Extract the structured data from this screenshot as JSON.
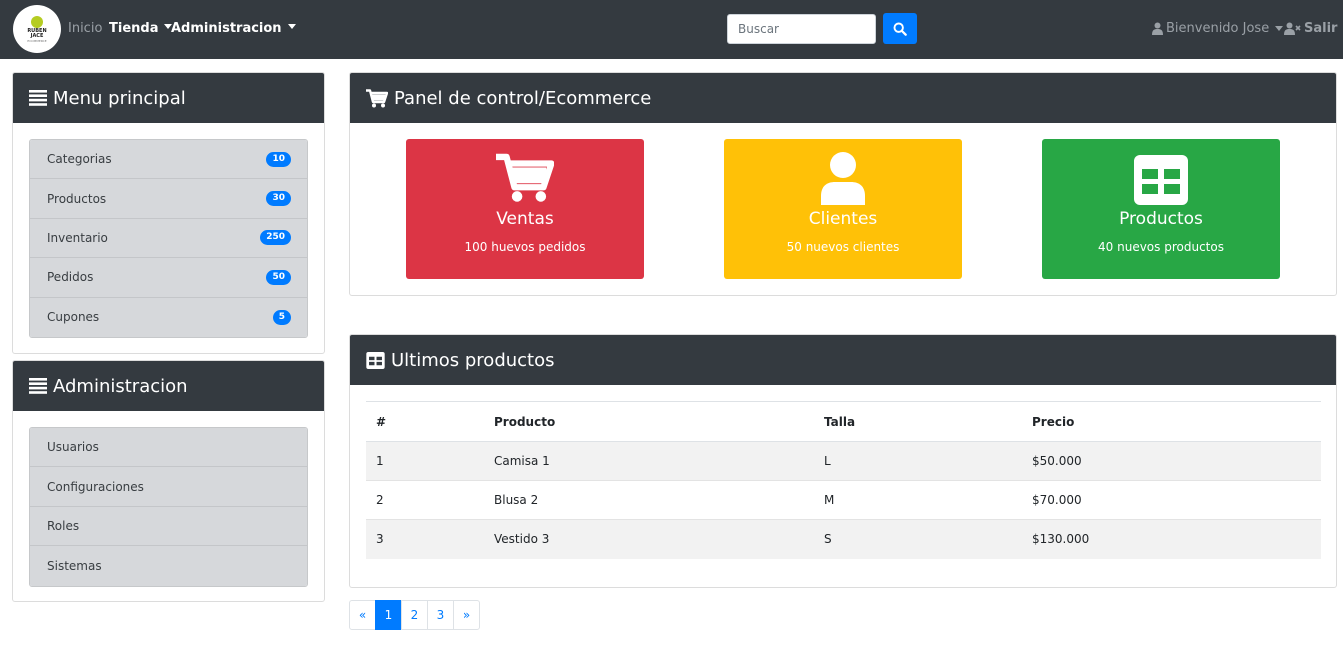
{
  "navbar": {
    "logo": {
      "line1": "RUBEN",
      "line2": "JACE",
      "line3": "ECOMMERCE"
    },
    "links": {
      "home": "Inicio",
      "store": "Tienda",
      "admin": "Administracion"
    },
    "search": {
      "placeholder": "Buscar"
    },
    "user": {
      "welcome": "Bienvenido Jose",
      "logout": "Salir"
    }
  },
  "main_menu": {
    "title": "Menu principal",
    "items": [
      {
        "label": "Categorias",
        "count": "10"
      },
      {
        "label": "Productos",
        "count": "30"
      },
      {
        "label": "Inventario",
        "count": "250"
      },
      {
        "label": "Pedidos",
        "count": "50"
      },
      {
        "label": "Cupones",
        "count": "5"
      }
    ]
  },
  "admin_menu": {
    "title": "Administracion",
    "items": [
      {
        "label": "Usuarios"
      },
      {
        "label": "Configuraciones"
      },
      {
        "label": "Roles"
      },
      {
        "label": "Sistemas"
      }
    ]
  },
  "dashboard": {
    "title": "Panel de control/Ecommerce",
    "tiles": [
      {
        "title": "Ventas",
        "subtitle": "100 huevos pedidos",
        "color": "#dc3545",
        "icon": "cart-icon"
      },
      {
        "title": "Clientes",
        "subtitle": "50 nuevos clientes",
        "color": "#ffc107",
        "icon": "user-icon"
      },
      {
        "title": "Productos",
        "subtitle": "40 nuevos productos",
        "color": "#28a745",
        "icon": "table-icon"
      }
    ]
  },
  "latest_products": {
    "title": "Ultimos productos",
    "columns": [
      "#",
      "Producto",
      "Talla",
      "Precio"
    ],
    "rows": [
      [
        "1",
        "Camisa 1",
        "L",
        "$50.000"
      ],
      [
        "2",
        "Blusa 2",
        "M",
        "$70.000"
      ],
      [
        "3",
        "Vestido 3",
        "S",
        "$130.000"
      ]
    ]
  },
  "pagination": {
    "prev": "«",
    "pages": [
      "1",
      "2",
      "3"
    ],
    "active": "1",
    "next": "»"
  },
  "colors": {
    "navbar": "#343a40",
    "primary": "#007bff",
    "danger": "#dc3545",
    "warning": "#ffc107",
    "success": "#28a745"
  }
}
